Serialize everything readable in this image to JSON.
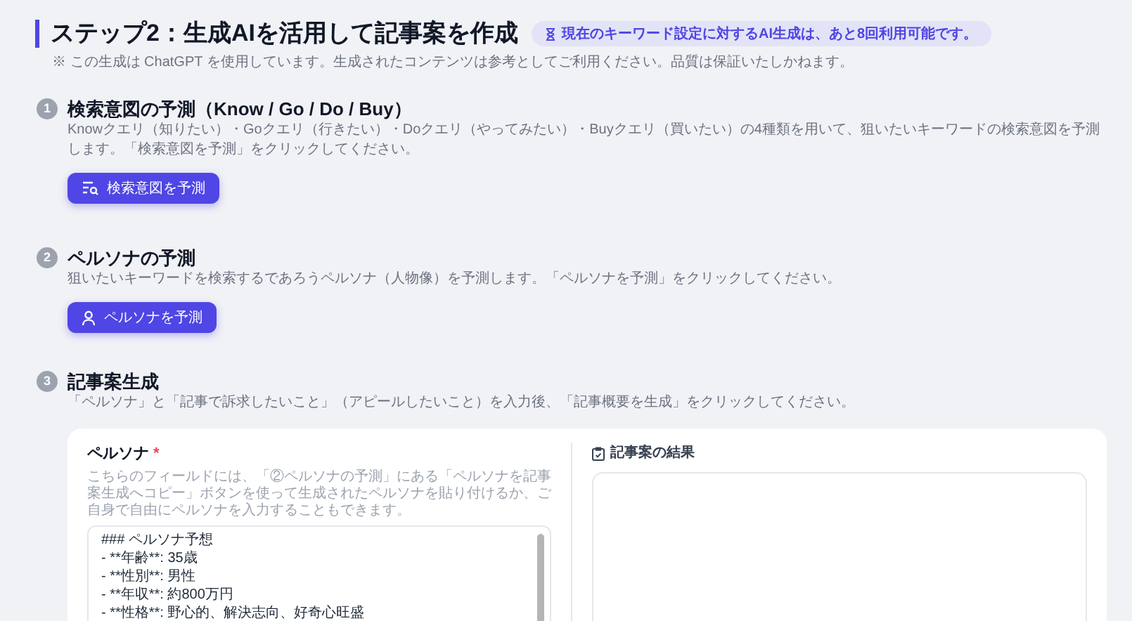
{
  "header": {
    "title": "ステップ2：生成AIを活用して記事案を作成",
    "quota_badge": "現在のキーワード設定に対するAI生成は、あと8回利用可能です。",
    "note": "※ この生成は ChatGPT を使用しています。生成されたコンテンツは参考としてご利用ください。品質は保証いたしかねます。"
  },
  "steps": [
    {
      "number": "1",
      "title": "検索意図の予測（Know / Go / Do / Buy）",
      "description": "Knowクエリ（知りたい）・Goクエリ（行きたい）・Doクエリ（やってみたい）・Buyクエリ（買いたい）の4種類を用いて、狙いたいキーワードの検索意図を予測します。「検索意図を予測」をクリックしてください。",
      "button": {
        "label": "検索意図を予測"
      }
    },
    {
      "number": "2",
      "title": "ペルソナの予測",
      "description": "狙いたいキーワードを検索するであろうペルソナ（人物像）を予測します。「ペルソナを予測」をクリックしてください。",
      "button": {
        "label": "ペルソナを予測"
      }
    },
    {
      "number": "3",
      "title": "記事案生成",
      "description": "「ペルソナ」と「記事で訴求したいこと」（アピールしたいこと）を入力後、「記事概要を生成」をクリックしてください。"
    }
  ],
  "form": {
    "persona": {
      "label": "ペルソナ",
      "required_mark": "*",
      "help": "こちらのフィールドには、「②ペルソナの予測」にある「ペルソナを記事案生成へコピー」ボタンを使って生成されたペルソナを貼り付けるか、ご自身で自由にペルソナを入力することもできます。",
      "value": "### ペルソナ予想\n- **年齢**: 35歳\n- **性別**: 男性\n- **年収**: 約800万円\n- **性格**: 野心的、解決志向、好奇心旺盛"
    },
    "result": {
      "label": "記事案の結果"
    }
  }
}
